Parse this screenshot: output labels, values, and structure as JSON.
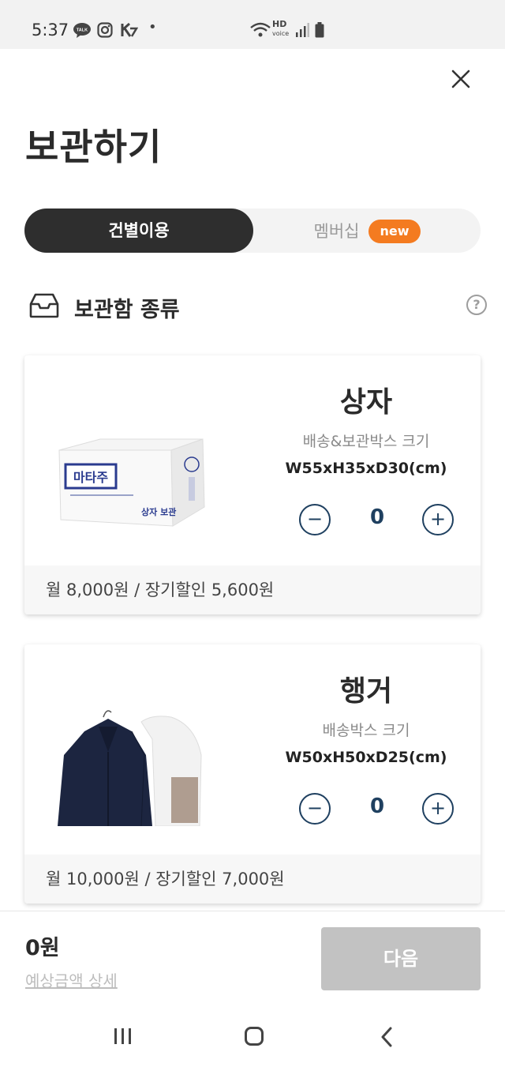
{
  "status_bar": {
    "time": "5:37",
    "icons": [
      "talk-icon",
      "instagram-icon",
      "k-app-icon",
      "wifi-icon",
      "hd-voice-icon",
      "signal-icon",
      "battery-icon"
    ],
    "hd_label": "HD",
    "voice_label": "voice",
    "talk_label": "TALK",
    "dot": "•"
  },
  "header": {
    "title": "보관하기",
    "close_icon": "close-icon"
  },
  "tabs": [
    {
      "label": "건별이용",
      "active": true
    },
    {
      "label": "멤버십",
      "badge": "new",
      "active": false
    }
  ],
  "section": {
    "title": "보관함 종류",
    "help_glyph": "?"
  },
  "items": [
    {
      "name": "상자",
      "subtitle": "배송&보관박스 크기",
      "dimensions": "W55xH35xD30(cm)",
      "quantity": "0",
      "price_text": "월 8,000원 / 장기할인 5,600원",
      "box_logo": "마타주",
      "box_caption": "상자 보관"
    },
    {
      "name": "행거",
      "subtitle": "배송박스 크기",
      "dimensions": "W50xH50xD25(cm)",
      "quantity": "0",
      "price_text": "월 10,000원 / 장기할인 7,000원"
    }
  ],
  "stepper": {
    "minus": "−",
    "plus": "+"
  },
  "footer": {
    "total": "0원",
    "detail_link": "예상금액 상세",
    "next_label": "다음"
  },
  "colors": {
    "accent": "#f47b20",
    "dark": "#2e2e2e",
    "stepper": "#1f4060",
    "disabled": "#c2c2c2"
  }
}
